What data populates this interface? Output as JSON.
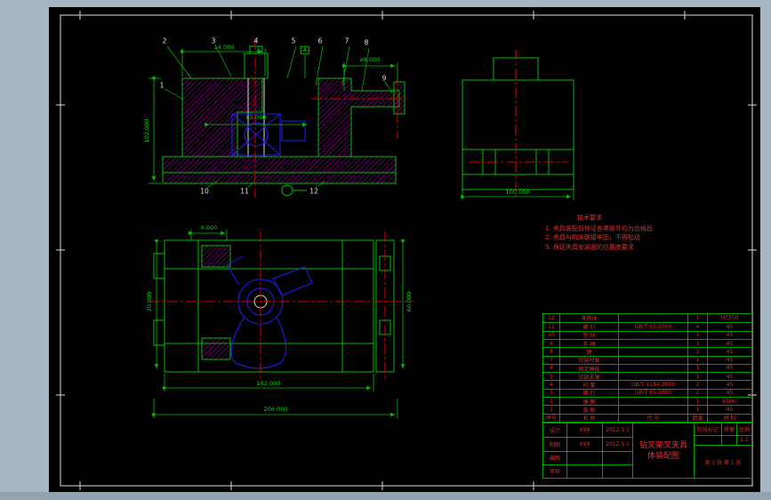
{
  "views": {
    "section": {
      "balloons": [
        "1",
        "2",
        "3",
        "4",
        "5",
        "6",
        "7",
        "8",
        "9",
        "10",
        "11",
        "12"
      ],
      "dims": {
        "left_height": "102.000",
        "top_width": "14.000",
        "datum": "A",
        "shaft": "⌀8.000",
        "inner_width": "85.000"
      }
    },
    "side": {
      "dims": {
        "width": "100.000"
      }
    },
    "plan": {
      "dims": {
        "top": "6.000",
        "left": "20.000",
        "right": "60.000",
        "inner": "162.000",
        "overall": "206.000"
      }
    }
  },
  "notes": {
    "title": "技术要求",
    "items": [
      "1. 夹具装配前保证各零部件均为合格品",
      "2. 夹具与机床联接牢固，不得松动",
      "3. 保证夹具安装面的位置度要求"
    ]
  },
  "bom": {
    "headers": [
      "序号",
      "名  称",
      "代  号",
      "数量",
      "材  料"
    ],
    "rows": [
      [
        "12",
        "夹具体",
        "",
        "1",
        "HT200"
      ],
      [
        "11",
        "螺 钉",
        "GB/T 65-2000",
        "4",
        "45"
      ],
      [
        "10",
        "垫 块",
        "",
        "1",
        "45"
      ],
      [
        "9",
        "手 柄",
        "",
        "1",
        "45"
      ],
      [
        "8",
        "键",
        "",
        "2",
        "45"
      ],
      [
        "7",
        "铰链衬套",
        "",
        "1",
        "45"
      ],
      [
        "6",
        "固定模板",
        "",
        "1",
        "45"
      ],
      [
        "5",
        "铰链支轴",
        "",
        "1",
        "45"
      ],
      [
        "4",
        "衬 套",
        "GB/T 1184-2000",
        "2",
        "45"
      ],
      [
        "3",
        "螺 钉",
        "GB/T 65-2000",
        "2",
        "45"
      ],
      [
        "2",
        "弹 簧",
        "",
        "1",
        "65Mn"
      ],
      [
        "1",
        "盖 板",
        "",
        "1",
        "45"
      ]
    ]
  },
  "title_block": {
    "title_line1": "钻叉架叉夹具",
    "title_line2": "体装配图",
    "left_rows": [
      [
        "设计",
        "XXX",
        "2012.1.1"
      ],
      [
        "制图",
        "XXX",
        "2012.1.1"
      ],
      [
        "描图",
        "",
        ""
      ],
      [
        "审核",
        "",
        ""
      ]
    ],
    "stage_label": "阶段标记",
    "mass_label": "质量",
    "scale_label": "比例",
    "scale_value": "1:1",
    "sheet": "共 1 张  第 1 张"
  }
}
